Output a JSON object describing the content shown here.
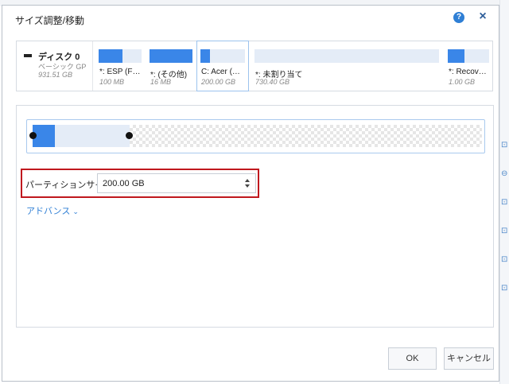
{
  "dialog": {
    "title": "サイズ調整/移動",
    "help_icon": "?",
    "close_icon": "×"
  },
  "disk": {
    "name": "ディスク 0",
    "type": "ベーシック GP",
    "size": "931.51 GB"
  },
  "partitions": [
    {
      "label": "*: ESP (F…",
      "size": "100 MB",
      "fill_pct": 55,
      "kind": "used"
    },
    {
      "label": "*: (その他)",
      "size": "16 MB",
      "fill_pct": 100,
      "kind": "used"
    },
    {
      "label": "C: Acer (…",
      "size": "200.00 GB",
      "fill_pct": 22,
      "kind": "used",
      "selected": true
    },
    {
      "label": "*: 未割り当て",
      "size": "730.40 GB",
      "fill_pct": 0,
      "kind": "unallocated"
    },
    {
      "label": "*: Recov…",
      "size": "1.00 GB",
      "fill_pct": 40,
      "kind": "used"
    }
  ],
  "editor": {
    "partition_size_label": "パーティションサイズ:",
    "partition_size_value": "200.00 GB",
    "advanced_label": "アドバンス",
    "advanced_chevron": "⌄"
  },
  "buttons": {
    "ok": "OK",
    "cancel": "キャンセル"
  },
  "colors": {
    "accent": "#2f7fd5",
    "partition_fill": "#3a86e8",
    "highlight_border": "#c0181e"
  }
}
